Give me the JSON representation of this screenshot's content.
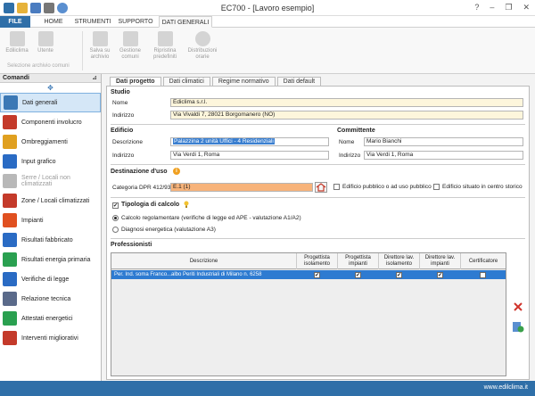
{
  "window": {
    "title": "EC700 - [Lavoro esempio]",
    "controls": [
      "?",
      "–",
      "❐",
      "✕"
    ]
  },
  "ribbon_tabs": [
    "FILE",
    "HOME",
    "STRUMENTI",
    "SUPPORTO",
    "DATI GENERALI"
  ],
  "ribbon": {
    "buttons": [
      "Ediliclima",
      "Utente",
      "Salva su archivio",
      "Gestione comuni",
      "Ripristina predefiniti",
      "Distribuzioni orarie"
    ],
    "group_label": "Selezione archivio comuni"
  },
  "sidebar": {
    "title": "Comandi",
    "pin": "⊿",
    "move": "✥",
    "items": [
      {
        "label": "Dati generali",
        "icon": "general-data-icon",
        "color": "#3b78b5"
      },
      {
        "label": "Componenti involucro",
        "icon": "envelope-components-icon",
        "color": "#c43a2a"
      },
      {
        "label": "Ombreggiamenti",
        "icon": "shading-icon",
        "color": "#e0a020"
      },
      {
        "label": "Input grafico",
        "icon": "graphic-input-icon",
        "color": "#2a6bc4"
      },
      {
        "label": "Serre / Locali non climatizzati",
        "icon": "greenhouse-icon",
        "color": "#b8b8b8"
      },
      {
        "label": "Zone / Locali climatizzati",
        "icon": "zones-icon",
        "color": "#c43a2a"
      },
      {
        "label": "Impianti",
        "icon": "plant-flame-icon",
        "color": "#e05020"
      },
      {
        "label": "Risultati fabbricato",
        "icon": "building-results-icon",
        "color": "#2a6bc4"
      },
      {
        "label": "Risultati energia primaria",
        "icon": "primary-energy-icon",
        "color": "#2aa050"
      },
      {
        "label": "Verifiche di legge",
        "icon": "law-checks-icon",
        "color": "#2a6bc4"
      },
      {
        "label": "Relazione tecnica",
        "icon": "technical-report-icon",
        "color": "#5a6a8a"
      },
      {
        "label": "Attestati energetici",
        "icon": "energy-certificate-icon",
        "color": "#2aa050"
      },
      {
        "label": "Interventi migliorativi",
        "icon": "improvements-icon",
        "color": "#c43a2a"
      }
    ]
  },
  "content_tabs": [
    "Dati progetto",
    "Dati climatici",
    "Regime normativo",
    "Dati default"
  ],
  "studio": {
    "title": "Studio",
    "nome_label": "Nome",
    "nome": "Ediclima s.r.l.",
    "indirizzo_label": "Indirizzo",
    "indirizzo": "Via Vivaldi 7, 28021 Borgomanero (NO)"
  },
  "edificio": {
    "title": "Edificio",
    "descrizione_label": "Descrizione",
    "descrizione": "Palazzina 2 unità Uffici - 4 Residenziali",
    "indirizzo_label": "Indirizzo",
    "indirizzo": "Via Verdi 1, Roma"
  },
  "committente": {
    "title": "Committente",
    "nome_label": "Nome",
    "nome": "Mario Bianchi",
    "indirizzo_label": "Indirizzo",
    "indirizzo": "Via Verdi 1, Roma"
  },
  "destinazione": {
    "title": "Destinazione d'uso",
    "categoria_label": "Categoria DPR 412/93",
    "categoria": "E.1 (1)",
    "pubblico_label": "Edificio pubblico o ad uso pubblico",
    "storico_label": "Edificio situato in centro storico"
  },
  "tipologia": {
    "title": "Tipologia di calcolo",
    "opt1": "Calcolo regolamentare (verifiche di legge ed APE - valutazione A1/A2)",
    "opt2": "Diagnosi energetica (valutazione A3)"
  },
  "professionisti": {
    "title": "Professionisti",
    "headers": [
      "Descrizione",
      "Progettista isolamento",
      "Progettista impianti",
      "Direttore lav. isolamento",
      "Direttore lav. impianti",
      "Certificatore"
    ],
    "row": {
      "descrizione": "Per. Ind. soma Franco...albo Periti Industriali di Milano n. 6258",
      "checks": [
        "✔",
        "✔",
        "✔",
        "✔",
        ""
      ]
    }
  },
  "status": {
    "url": "www.edilclima.it"
  },
  "colors": {
    "accent": "#2f6fa8",
    "selected_row": "#2e7bd1",
    "required_bg": "#fdf6dc",
    "category_bg": "#f7b37a"
  }
}
